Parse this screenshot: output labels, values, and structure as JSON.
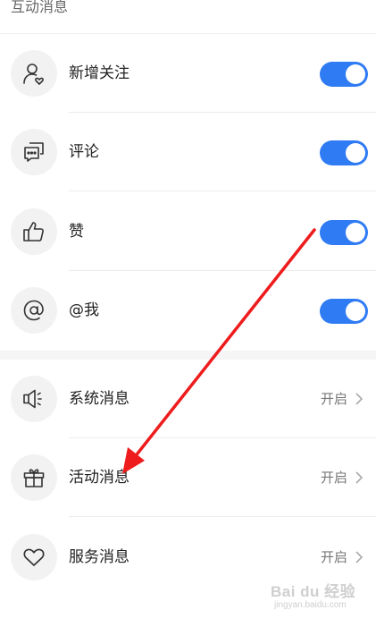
{
  "section": {
    "title": "互动消息"
  },
  "toggle_rows": [
    {
      "label": "新增关注",
      "icon": "user-heart-icon",
      "enabled": true
    },
    {
      "label": "评论",
      "icon": "comment-icon",
      "enabled": true
    },
    {
      "label": "赞",
      "icon": "thumbs-up-icon",
      "enabled": true
    },
    {
      "label": "@我",
      "icon": "at-mention-icon",
      "enabled": true
    }
  ],
  "link_rows": [
    {
      "label": "系统消息",
      "icon": "speaker-icon",
      "status": "开启"
    },
    {
      "label": "活动消息",
      "icon": "gift-icon",
      "status": "开启"
    },
    {
      "label": "服务消息",
      "icon": "heart-icon",
      "status": "开启"
    }
  ],
  "colors": {
    "toggle_on": "#2f7bf4",
    "annotation_arrow": "#ee1c1c",
    "separator": "#f5f5f5"
  },
  "watermark": {
    "brand": "Bai du 经验",
    "url": "jingyan.baidu.com"
  }
}
